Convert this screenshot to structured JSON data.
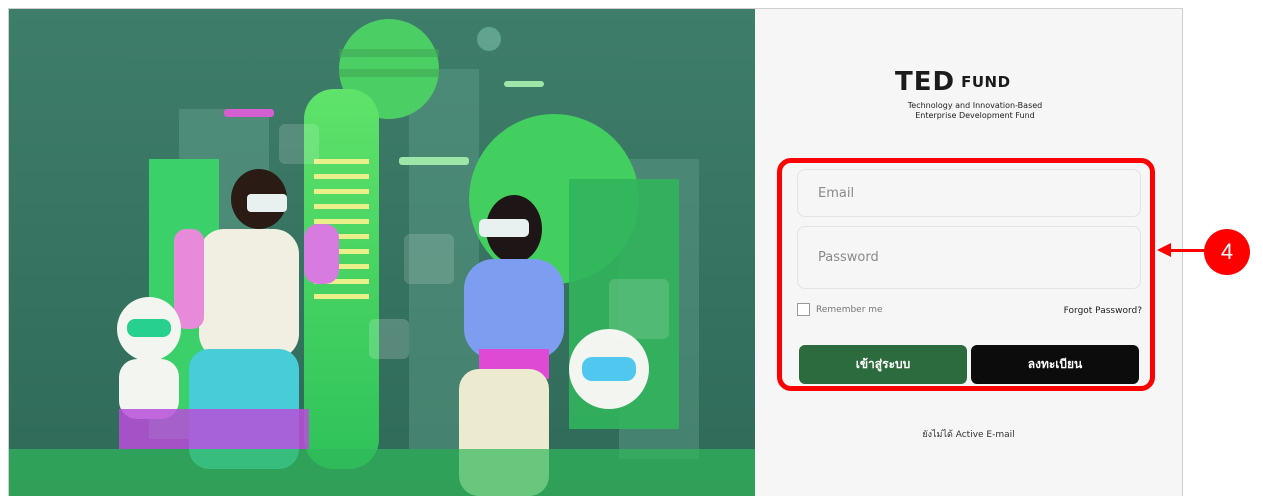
{
  "logo": {
    "brand_left": "T",
    "brand_mid": "ED",
    "brand_right": "FUND",
    "subtitle_line1": "Technology and Innovation-Based",
    "subtitle_line2": "Enterprise Development Fund"
  },
  "form": {
    "email_placeholder": "Email",
    "password_placeholder": "Password",
    "remember_label": "Remember me",
    "forgot_label": "Forgot Password?",
    "login_label": "เข้าสู่ระบบ",
    "register_label": "ลงทะเบียน",
    "active_email_label": "ยังไม่ได้ Active E-mail"
  },
  "annotation": {
    "step_number": "4"
  },
  "colors": {
    "login_button": "#2c6b3e",
    "register_button": "#0c0c0c",
    "annotation": "#ff0000",
    "hero_bg": "#3a7566"
  }
}
